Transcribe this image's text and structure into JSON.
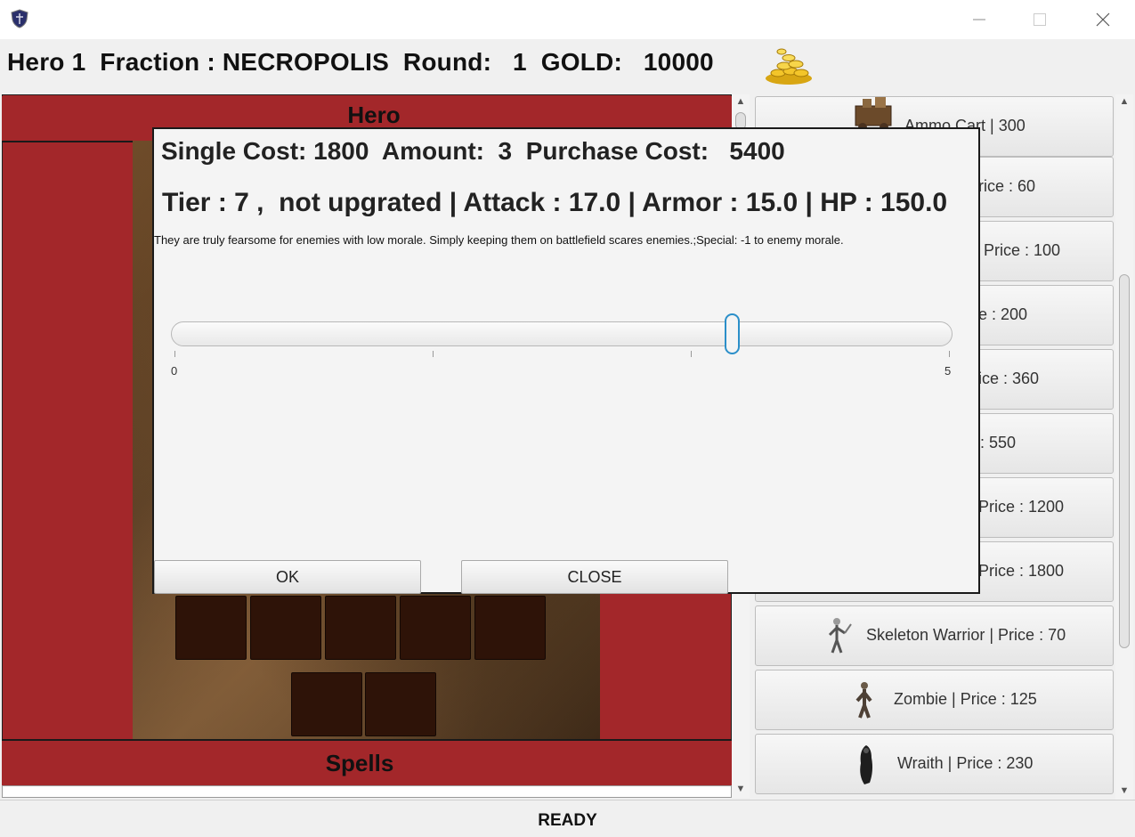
{
  "window": {
    "title": "",
    "controls": [
      "minimize-icon",
      "maximize-icon",
      "close-icon"
    ]
  },
  "infobar": {
    "text": "Hero 1  Fraction : NECROPOLIS  Round:   1  GOLD:   10000",
    "gold_icon": "gold-coins-icon"
  },
  "left_panel": {
    "hero_label": "Hero",
    "spells_label": "Spells"
  },
  "shop": {
    "items": [
      {
        "label": "Ammo Cart | 300",
        "icon": "ammo-cart-icon"
      },
      {
        "label": "rice : 60",
        "icon": ""
      },
      {
        "label": "Price : 100",
        "icon": ""
      },
      {
        "label": "e : 200",
        "icon": ""
      },
      {
        "label": "ice : 360",
        "icon": ""
      },
      {
        "label": ": 550",
        "icon": ""
      },
      {
        "label": "Price : 1200",
        "icon": ""
      },
      {
        "label": "Price : 1800",
        "icon": ""
      },
      {
        "label": "Skeleton Warrior | Price : 70",
        "icon": "skeleton-warrior-icon"
      },
      {
        "label": "Zombie | Price : 125",
        "icon": "zombie-icon"
      },
      {
        "label": "Wraith | Price : 230",
        "icon": "wraith-icon"
      }
    ]
  },
  "dialog": {
    "cost_line": "Single Cost: 1800  Amount:  3  Purchase Cost:   5400",
    "stats_line": "Tier : 7 ,  not upgrated | Attack : 17.0 | Armor : 15.0 | HP : 150.0",
    "description": "They are truly fearsome for enemies with low morale. Simply keeping them on battlefield scares enemies.;Special: -1 to enemy morale.",
    "slider": {
      "min": "0",
      "max": "5",
      "value": 3.6
    },
    "ok_label": "OK",
    "close_label": "CLOSE"
  },
  "status": {
    "text": "READY"
  },
  "colors": {
    "panel_red": "#a3272a",
    "slot_brown": "#2e1308",
    "slider_accent": "#2b8fc9"
  }
}
